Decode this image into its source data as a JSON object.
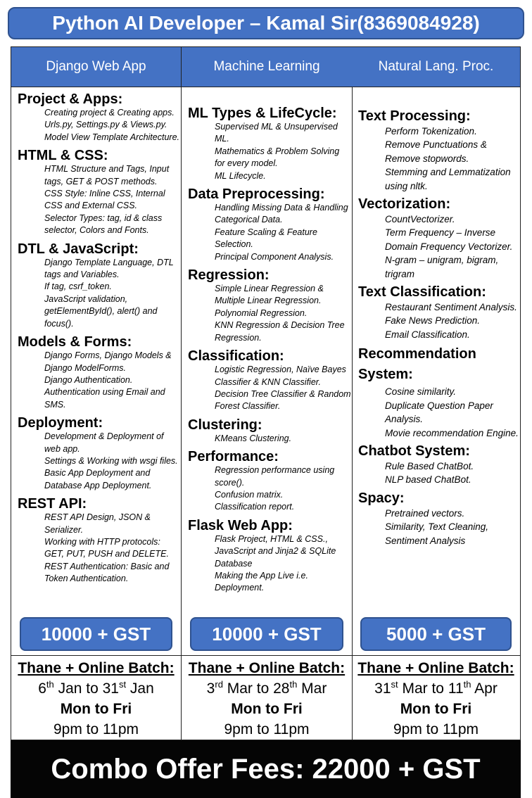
{
  "title": "Python AI Developer – Kamal Sir(8369084928)",
  "columns": [
    {
      "header": "Django Web App",
      "sections": [
        {
          "title": "Project & Apps:",
          "items": [
            "Creating project &  Creating apps.",
            "Urls.py, Settings.py & Views.py.",
            "Model View Template Architecture."
          ]
        },
        {
          "title": "HTML & CSS:",
          "items": [
            "HTML Structure and Tags,  Input tags, GET & POST methods.",
            "CSS Style: Inline CSS,  Internal CSS and External CSS.",
            "Selector Types: tag, id & class selector, Colors and Fonts."
          ]
        },
        {
          "title": "DTL & JavaScript:",
          "items": [
            "Django Template Language, DTL tags and Variables.",
            "If tag, csrf_token.",
            "JavaScript validation, getElementById(), alert() and focus()."
          ]
        },
        {
          "title": "Models & Forms:",
          "items": [
            "Django Forms, Django Models & Django ModelForms.",
            "Django Authentication.",
            "Authentication using Email and SMS."
          ]
        },
        {
          "title": "Deployment:",
          "items": [
            "Development & Deployment of web app.",
            "Settings & Working  with wsgi files.",
            "Basic App Deployment and Database App Deployment."
          ]
        },
        {
          "title": "REST API:",
          "items": [
            "REST API Design, JSON & Serializer.",
            "Working with HTTP protocols: GET, PUT, PUSH and DELETE.",
            "REST Authentication: Basic and Token Authentication."
          ]
        }
      ],
      "price": "10000 + GST",
      "batch": {
        "title": "Thane + Online Batch:",
        "d1": "6",
        "s1": "th",
        "mid": " Jan to 31",
        "s2": "st",
        "end": " Jan",
        "days": "Mon to Fri",
        "time": "9pm to 11pm"
      }
    },
    {
      "header": "Machine Learning",
      "sections": [
        {
          "title": "ML Types & LifeCycle:",
          "items": [
            "Supervised ML & Unsupervised ML.",
            "Mathematics & Problem Solving for every model.",
            "ML Lifecycle."
          ]
        },
        {
          "title": "Data Preprocessing:",
          "items": [
            "Handling Missing Data & Handling Categorical Data.",
            "Feature Scaling & Feature Selection.",
            "Principal Component Analysis."
          ]
        },
        {
          "title": "Regression:",
          "items": [
            "Simple Linear Regression & Multiple Linear Regression.",
            "Polynomial Regression.",
            "KNN Regression & Decision Tree Regression."
          ]
        },
        {
          "title": "Classification:",
          "items": [
            "Logistic Regression, Naïve Bayes Classifier & KNN Classifier.",
            "Decision Tree Classifier & Random Forest Classifier."
          ]
        },
        {
          "title": "Clustering:",
          "items": [
            "KMeans Clustering."
          ]
        },
        {
          "title": "Performance:",
          "items": [
            "Regression performance using score().",
            "Confusion matrix.",
            "Classification report."
          ]
        },
        {
          "title": "Flask Web App:",
          "items": [
            "Flask Project, HTML & CSS., JavaScript  and Jinja2 & SQLite Database",
            "Making the App Live i.e. Deployment."
          ]
        }
      ],
      "price": "10000 + GST",
      "batch": {
        "title": "Thane + Online Batch:",
        "d1": "3",
        "s1": "rd",
        "mid": " Mar to 28",
        "s2": "th",
        "end": " Mar",
        "days": "Mon to Fri",
        "time": "9pm to 11pm"
      }
    },
    {
      "header": "Natural Lang. Proc.",
      "sections": [
        {
          "title": "Text Processing:",
          "items": [
            "Perform Tokenization.",
            "Remove Punctuations & Remove stopwords.",
            "Stemming and Lemmatization using nltk."
          ]
        },
        {
          "title": "Vectorization:",
          "items": [
            "CountVectorizer.",
            "Term Frequency – Inverse Domain Frequency Vectorizer.",
            "N-gram – unigram, bigram, trigram"
          ]
        },
        {
          "title": "Text Classification:",
          "items": [
            "Restaurant Sentiment Analysis.",
            "Fake News Prediction.",
            "Email Classification."
          ]
        },
        {
          "title": "Recommendation System:",
          "items": [
            "Cosine similarity.",
            "Duplicate Question Paper Analysis.",
            "Movie recommendation Engine."
          ]
        },
        {
          "title": "Chatbot System:",
          "items": [
            "Rule Based ChatBot.",
            "NLP based ChatBot."
          ]
        },
        {
          "title": "Spacy:",
          "items": [
            "Pretrained vectors.",
            "Similarity, Text Cleaning, Sentiment Analysis"
          ]
        }
      ],
      "price": "5000 + GST",
      "batch": {
        "title": "Thane + Online Batch:",
        "d1": "31",
        "s1": "st",
        "mid": " Mar to 11",
        "s2": "th",
        "end": " Apr",
        "days": "Mon to Fri",
        "time": "9pm to 11pm"
      }
    }
  ],
  "combo": "Combo Offer Fees: 22000 + GST"
}
